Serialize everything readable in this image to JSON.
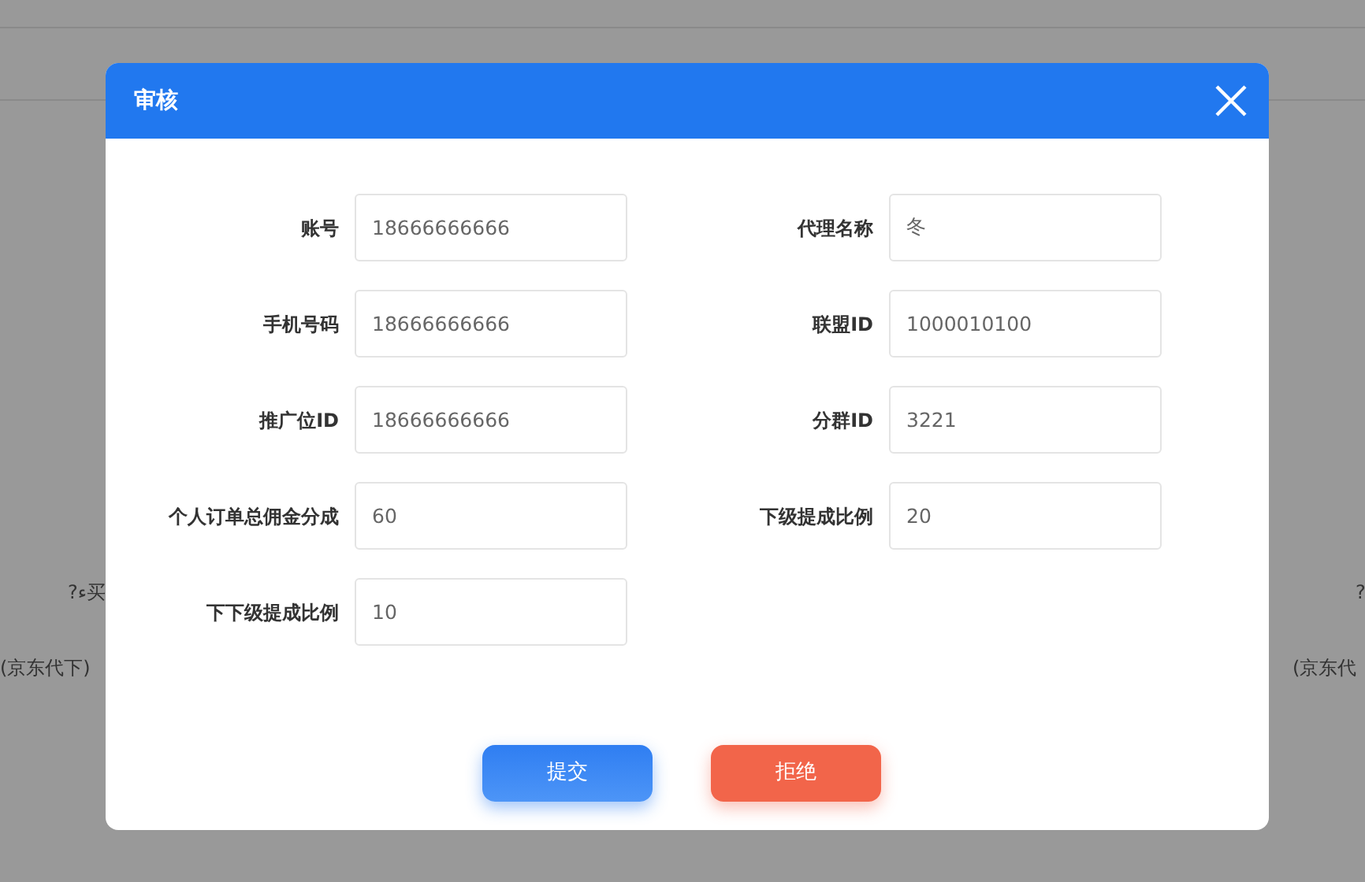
{
  "background": {
    "left_texts": [
      "?ء买",
      "(京东代下)"
    ],
    "right_texts": [
      "?",
      "(京东代"
    ]
  },
  "dialog": {
    "title": "审核",
    "rows": [
      [
        {
          "label": "账号",
          "value": "18666666666"
        },
        {
          "label": "代理名称",
          "value": "冬"
        }
      ],
      [
        {
          "label": "手机号码",
          "value": "18666666666"
        },
        {
          "label": "联盟ID",
          "value": "1000010100"
        }
      ],
      [
        {
          "label": "推广位ID",
          "value": "18666666666"
        },
        {
          "label": "分群ID",
          "value": "3221"
        }
      ],
      [
        {
          "label": "个人订单总佣金分成",
          "value": "60"
        },
        {
          "label": "下级提成比例",
          "value": "20"
        }
      ],
      [
        {
          "label": "下下级提成比例",
          "value": "10"
        }
      ]
    ],
    "buttons": [
      {
        "label": "提交",
        "kind": "primary"
      },
      {
        "label": "拒绝",
        "kind": "danger"
      }
    ]
  }
}
